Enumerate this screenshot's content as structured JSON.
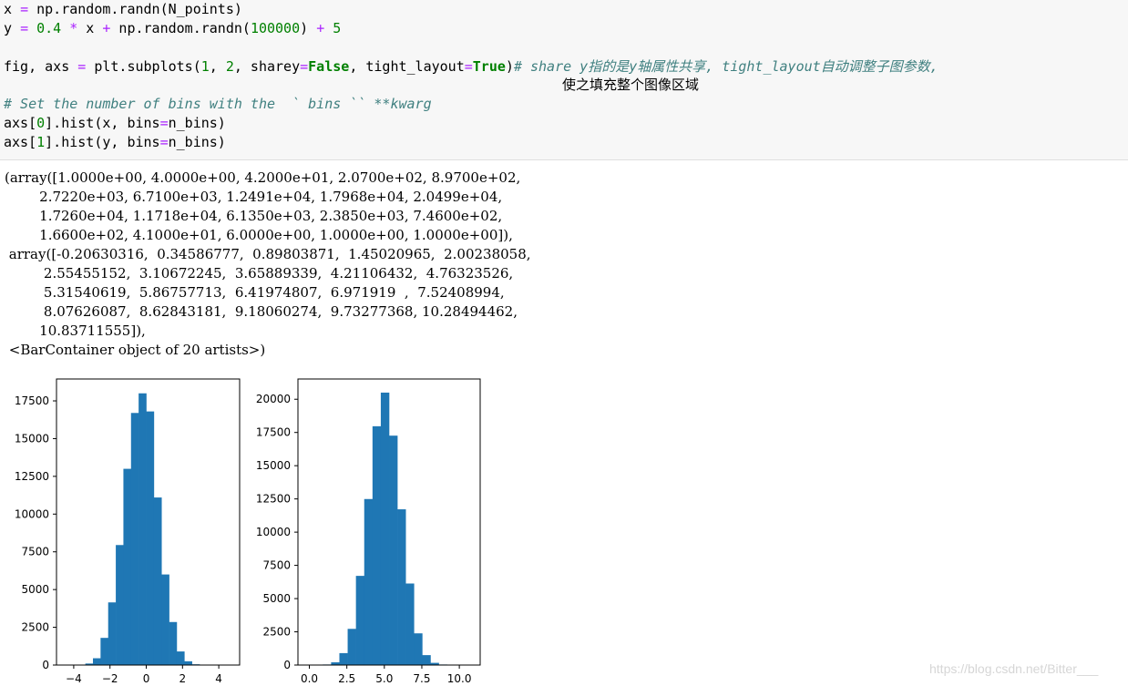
{
  "code": {
    "line1_a": "x ",
    "line1_op": "=",
    "line1_b": " np.random.randn(N_points)",
    "line2_a": "y ",
    "line2_op1": "=",
    "line2_num1": " 0.4",
    "line2_op2": " *",
    "line2_b": " x ",
    "line2_op3": "+",
    "line2_c": " np.random.randn(",
    "line2_num2": "100000",
    "line2_d": ") ",
    "line2_op4": "+",
    "line2_num3": " 5",
    "line4_a": "fig, axs ",
    "line4_op1": "=",
    "line4_b": " plt.subplots(",
    "line4_num1": "1",
    "line4_c": ", ",
    "line4_num2": "2",
    "line4_d": ", sharey",
    "line4_op2": "=",
    "line4_kw1": "False",
    "line4_e": ", tight_layout",
    "line4_op3": "=",
    "line4_kw2": "True",
    "line4_f": ")",
    "line4_comment": "# share y指的是y轴属性共享, tight_layout自动调整子图参数,",
    "line4_continuation": "使之填充整个图像区域",
    "line5_comment": "# Set the number of bins with the  ` bins `` **kwarg",
    "line6_a": "axs[",
    "line6_num": "0",
    "line6_b": "].hist(x, bins",
    "line6_op": "=",
    "line6_c": "n_bins)",
    "line7_a": "axs[",
    "line7_num": "1",
    "line7_b": "].hist(y, bins",
    "line7_op": "=",
    "line7_c": "n_bins)"
  },
  "output": {
    "lines": [
      "(array([1.0000e+00, 4.0000e+00, 4.2000e+01, 2.0700e+02, 8.9700e+02,",
      "        2.7220e+03, 6.7100e+03, 1.2491e+04, 1.7968e+04, 2.0499e+04,",
      "        1.7260e+04, 1.1718e+04, 6.1350e+03, 2.3850e+03, 7.4600e+02,",
      "        1.6600e+02, 4.1000e+01, 6.0000e+00, 1.0000e+00, 1.0000e+00]),",
      " array([-0.20630316,  0.34586777,  0.89803871,  1.45020965,  2.00238058,",
      "         2.55455152,  3.10672245,  3.65889339,  4.21106432,  4.76323526,",
      "         5.31540619,  5.86757713,  6.41974807,  6.971919  ,  7.52408994,",
      "         8.07626087,  8.62843181,  9.18060274,  9.73277368, 10.28494462,",
      "        10.83711555]),",
      " <BarContainer object of 20 artists>)"
    ]
  },
  "watermark": "https://blog.csdn.net/Bitter___",
  "chart_data": [
    {
      "type": "bar",
      "histogram": true,
      "color": "#1f77b4",
      "bin_edges": [
        -4.2,
        -3.78,
        -3.36,
        -2.94,
        -2.52,
        -2.1,
        -1.68,
        -1.26,
        -0.84,
        -0.42,
        0.0,
        0.42,
        0.84,
        1.26,
        1.68,
        2.1,
        2.52,
        2.94,
        3.36,
        3.78,
        4.2
      ],
      "values": [
        1,
        10,
        100,
        450,
        1800,
        4150,
        7950,
        13000,
        16700,
        18000,
        16800,
        11100,
        6000,
        2850,
        900,
        250,
        50,
        10,
        2,
        1
      ],
      "xticks": [
        -4,
        -2,
        0,
        2,
        4
      ],
      "xtick_labels": [
        "−4",
        "−2",
        "0",
        "2",
        "4"
      ],
      "xlim": [
        -4.95,
        5.15
      ],
      "yticks": [
        0,
        2500,
        5000,
        7500,
        10000,
        12500,
        15000,
        17500
      ],
      "ylim": [
        0,
        18950
      ],
      "title": "",
      "xlabel": "",
      "ylabel": ""
    },
    {
      "type": "bar",
      "histogram": true,
      "color": "#1f77b4",
      "bin_edges": [
        -0.20630316,
        0.34586777,
        0.89803871,
        1.45020965,
        2.00238058,
        2.55455152,
        3.10672245,
        3.65889339,
        4.21106432,
        4.76323526,
        5.31540619,
        5.86757713,
        6.41974807,
        6.971919,
        7.52408994,
        8.07626087,
        8.62843181,
        9.18060274,
        9.73277368,
        10.28494462,
        10.83711555
      ],
      "values": [
        1,
        4,
        42,
        207,
        897,
        2722,
        6710,
        12491,
        17968,
        20499,
        17260,
        11718,
        6135,
        2385,
        746,
        166,
        41,
        6,
        1,
        1
      ],
      "xticks": [
        0,
        2.5,
        5,
        7.5,
        10
      ],
      "xtick_labels": [
        "0.0",
        "2.5",
        "5.0",
        "7.5",
        "10.0"
      ],
      "xlim": [
        -0.76,
        11.39
      ],
      "yticks": [
        0,
        2500,
        5000,
        7500,
        10000,
        12500,
        15000,
        17500,
        20000
      ],
      "ylim": [
        0,
        21524
      ],
      "title": "",
      "xlabel": "",
      "ylabel": ""
    }
  ]
}
